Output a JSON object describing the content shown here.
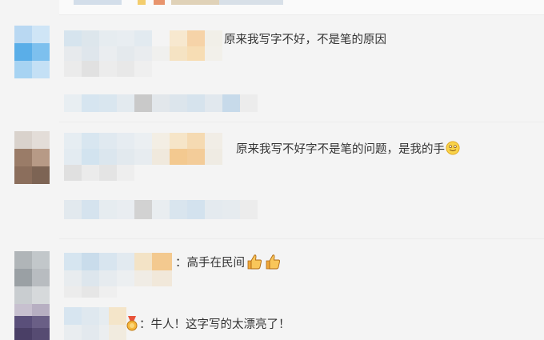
{
  "comments": [
    {
      "text": "原来我写字不好，不是笔的原因"
    },
    {
      "text": "原来我写不好字不是笔的问题，是我的手"
    },
    {
      "text": "：高手在民间"
    },
    {
      "text": "：牛人！这字写的太漂亮了！"
    }
  ],
  "icons": {
    "smile": "smile-emoji-icon",
    "thumbs_up": "thumbs-up-icon",
    "badge": "medal-badge-icon"
  },
  "colors": {
    "background": "#f4f4f4",
    "text": "#333333"
  }
}
